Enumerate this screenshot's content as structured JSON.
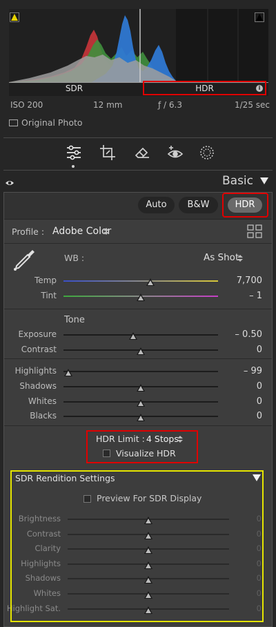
{
  "histogram": {
    "sdr_label": "SDR",
    "hdr_label": "HDR",
    "info_icon": "i",
    "shadow_clip_icon": "triangle-warning-icon",
    "highlight_clip_icon": "triangle-warning-icon"
  },
  "exif": {
    "iso": "ISO 200",
    "focal_length": "12 mm",
    "aperture": "ƒ / 6.3",
    "shutter": "1/25 sec"
  },
  "original_photo_label": "Original Photo",
  "tools": [
    "edit-sliders-icon",
    "crop-icon",
    "eraser-icon",
    "red-eye-icon",
    "masking-icon"
  ],
  "panel": {
    "title": "Basic",
    "buttons": {
      "auto": "Auto",
      "bw": "B&W",
      "hdr": "HDR"
    },
    "profile_label": "Profile :",
    "profile_value": "Adobe Color",
    "wb_label": "WB :",
    "wb_value": "As Shot",
    "tone_label": "Tone",
    "hdr_limit_label": "HDR Limit :",
    "hdr_limit_value": "4 Stops",
    "visualize_hdr_label": "Visualize HDR"
  },
  "sliders": {
    "temp": {
      "label": "Temp",
      "value": "7,700"
    },
    "tint": {
      "label": "Tint",
      "value": "– 1"
    },
    "exposure": {
      "label": "Exposure",
      "value": "– 0.50"
    },
    "contrast": {
      "label": "Contrast",
      "value": "0"
    },
    "highlights": {
      "label": "Highlights",
      "value": "– 99"
    },
    "shadows": {
      "label": "Shadows",
      "value": "0"
    },
    "whites": {
      "label": "Whites",
      "value": "0"
    },
    "blacks": {
      "label": "Blacks",
      "value": "0"
    }
  },
  "sdr_rendition": {
    "title": "SDR Rendition Settings",
    "preview_label": "Preview For SDR Display",
    "sliders": [
      {
        "label": "Brightness",
        "value": "0"
      },
      {
        "label": "Contrast",
        "value": "0"
      },
      {
        "label": "Clarity",
        "value": "0"
      },
      {
        "label": "Highlights",
        "value": "0"
      },
      {
        "label": "Shadows",
        "value": "0"
      },
      {
        "label": "Whites",
        "value": "0"
      },
      {
        "label": "Highlight Sat.",
        "value": "0"
      }
    ]
  },
  "colors": {
    "highlight_red": "#e00000",
    "highlight_yellow": "#e5e500",
    "panel_bg": "#3d3d3d",
    "app_bg": "#262626"
  }
}
